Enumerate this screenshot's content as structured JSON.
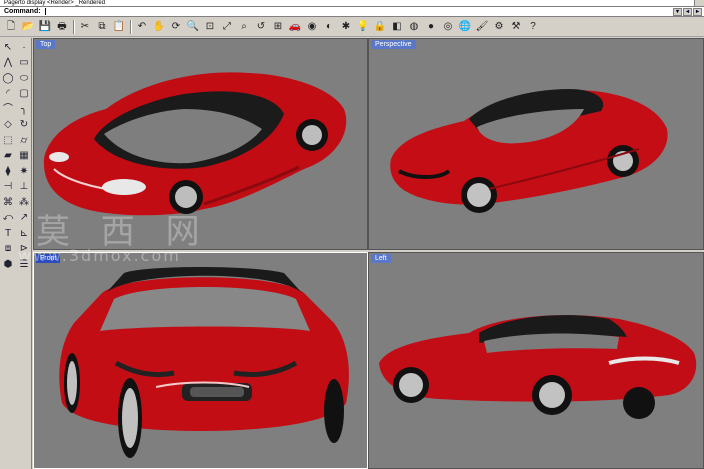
{
  "history": {
    "text": "Pagerto display <Render> _Rendered"
  },
  "command": {
    "label": "Command:",
    "value": ""
  },
  "toolbar": {
    "icons": [
      {
        "name": "new-icon",
        "glyph": "🗋"
      },
      {
        "name": "open-icon",
        "glyph": "📂"
      },
      {
        "name": "save-icon",
        "glyph": "💾"
      },
      {
        "name": "print-icon",
        "glyph": "🖶"
      },
      {
        "name": "sep"
      },
      {
        "name": "cut-icon",
        "glyph": "✂"
      },
      {
        "name": "copy-icon",
        "glyph": "⧉"
      },
      {
        "name": "paste-icon",
        "glyph": "📋"
      },
      {
        "name": "sep"
      },
      {
        "name": "undo-icon",
        "glyph": "↶"
      },
      {
        "name": "pan-icon",
        "glyph": "✋"
      },
      {
        "name": "rotate-view-icon",
        "glyph": "⟳"
      },
      {
        "name": "zoom-icon",
        "glyph": "🔍"
      },
      {
        "name": "zoom-window-icon",
        "glyph": "⊡"
      },
      {
        "name": "zoom-extents-icon",
        "glyph": "⤢"
      },
      {
        "name": "zoom-selected-icon",
        "glyph": "⌕"
      },
      {
        "name": "undo-view-icon",
        "glyph": "↺"
      },
      {
        "name": "four-viewports-icon",
        "glyph": "⊞"
      },
      {
        "name": "car-icon",
        "glyph": "🚗"
      },
      {
        "name": "hide-icon",
        "glyph": "◉"
      },
      {
        "name": "show-icon",
        "glyph": "◐"
      },
      {
        "name": "snap-icon",
        "glyph": "✱"
      },
      {
        "name": "light-icon",
        "glyph": "💡"
      },
      {
        "name": "lock-icon",
        "glyph": "🔒"
      },
      {
        "name": "layer-icon",
        "glyph": "◧"
      },
      {
        "name": "color-wheel-icon",
        "glyph": "◍"
      },
      {
        "name": "shaded-icon",
        "glyph": "●"
      },
      {
        "name": "render-icon",
        "glyph": "◎"
      },
      {
        "name": "globe-icon",
        "glyph": "🌐"
      },
      {
        "name": "paint-icon",
        "glyph": "🖌"
      },
      {
        "name": "settings-icon",
        "glyph": "⚙"
      },
      {
        "name": "options-icon",
        "glyph": "⚒"
      },
      {
        "name": "help-icon",
        "glyph": "?"
      }
    ]
  },
  "sidebar": {
    "icons": [
      {
        "name": "select-icon",
        "glyph": "↖"
      },
      {
        "name": "point-icon",
        "glyph": "·"
      },
      {
        "name": "polyline-icon",
        "glyph": "⋀"
      },
      {
        "name": "rectangle-icon",
        "glyph": "▭"
      },
      {
        "name": "circle-icon",
        "glyph": "◯"
      },
      {
        "name": "ellipse-icon",
        "glyph": "⬭"
      },
      {
        "name": "arc-icon",
        "glyph": "◜"
      },
      {
        "name": "rect-icon",
        "glyph": "▢"
      },
      {
        "name": "curve-icon",
        "glyph": "⌒"
      },
      {
        "name": "fillet-icon",
        "glyph": "╮"
      },
      {
        "name": "surface-icon",
        "glyph": "◇"
      },
      {
        "name": "revolve-icon",
        "glyph": "↻"
      },
      {
        "name": "box-icon",
        "glyph": "⬚"
      },
      {
        "name": "cylinder-icon",
        "glyph": "⌭"
      },
      {
        "name": "extrude-icon",
        "glyph": "▰"
      },
      {
        "name": "mesh-icon",
        "glyph": "▦"
      },
      {
        "name": "boolean-icon",
        "glyph": "⧫"
      },
      {
        "name": "explode-icon",
        "glyph": "✷"
      },
      {
        "name": "trim-icon",
        "glyph": "⊣"
      },
      {
        "name": "split-icon",
        "glyph": "⊥"
      },
      {
        "name": "join-icon",
        "glyph": "⌘"
      },
      {
        "name": "group-icon",
        "glyph": "⁂"
      },
      {
        "name": "move-icon",
        "glyph": "⤺"
      },
      {
        "name": "copy-obj-icon",
        "glyph": "↗"
      },
      {
        "name": "text-icon",
        "glyph": "T"
      },
      {
        "name": "dimension-icon",
        "glyph": "⊾"
      },
      {
        "name": "block-icon",
        "glyph": "⧈"
      },
      {
        "name": "analyze-icon",
        "glyph": "⊳"
      },
      {
        "name": "render-mesh-icon",
        "glyph": "⬢"
      },
      {
        "name": "properties-icon",
        "glyph": "☰"
      }
    ]
  },
  "viewports": {
    "top": "Top",
    "perspective": "Perspective",
    "front": "Front",
    "left": "Left"
  },
  "watermark": {
    "chars": "莫 西 网",
    "url": "www.3dmox.com"
  },
  "colors": {
    "viewport_bg": "#7f7f7f",
    "car_body": "#c80a12",
    "roof": "#1a1a1a",
    "glass": "#8a8a8a"
  }
}
